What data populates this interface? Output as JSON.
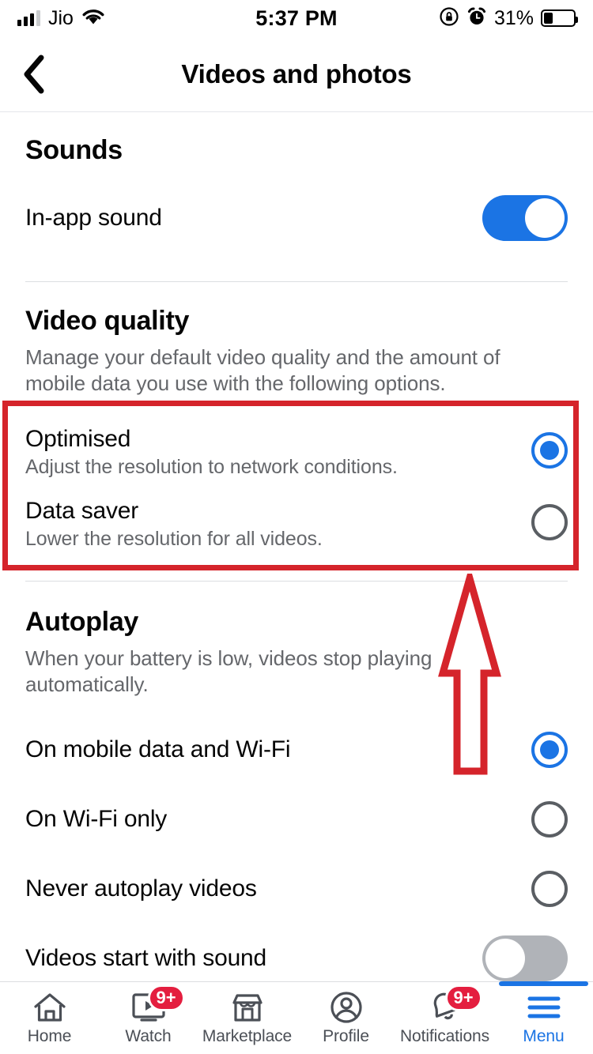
{
  "status_bar": {
    "carrier": "Jio",
    "time": "5:37 PM",
    "battery_percent": "31%",
    "icons": [
      "signal-bars-icon",
      "wifi-icon",
      "rotation-lock-icon",
      "alarm-icon",
      "battery-icon"
    ]
  },
  "header": {
    "back_icon": "chevron-left-icon",
    "title": "Videos and photos"
  },
  "sounds": {
    "heading": "Sounds",
    "in_app_sound": {
      "label": "In-app sound",
      "toggle_state": "on"
    }
  },
  "video_quality": {
    "heading": "Video quality",
    "description": "Manage your default video quality and the amount of mobile data you use with the following options.",
    "options": [
      {
        "title": "Optimised",
        "description": "Adjust the resolution to network conditions.",
        "selected": true
      },
      {
        "title": "Data saver",
        "description": "Lower the resolution for all videos.",
        "selected": false
      }
    ]
  },
  "autoplay": {
    "heading": "Autoplay",
    "description": "When your battery is low, videos stop playing automatically.",
    "options": [
      {
        "title": "On mobile data and Wi-Fi",
        "selected": true
      },
      {
        "title": "On Wi-Fi only",
        "selected": false
      },
      {
        "title": "Never autoplay videos",
        "selected": false
      }
    ],
    "videos_start_with_sound": {
      "label": "Videos start with sound",
      "toggle_state": "off"
    }
  },
  "annotation": {
    "color": "#d5242b",
    "box_target": "video-quality-options",
    "arrow_direction": "up"
  },
  "tab_bar": {
    "tabs": [
      {
        "label": "Home",
        "icon": "home-icon",
        "badge": "",
        "active": false
      },
      {
        "label": "Watch",
        "icon": "watch-video-icon",
        "badge": "9+",
        "active": false
      },
      {
        "label": "Marketplace",
        "icon": "marketplace-store-icon",
        "badge": "",
        "active": false
      },
      {
        "label": "Profile",
        "icon": "profile-person-icon",
        "badge": "",
        "active": false
      },
      {
        "label": "Notifications",
        "icon": "bell-icon",
        "badge": "9+",
        "active": false
      },
      {
        "label": "Menu",
        "icon": "hamburger-menu-icon",
        "badge": "",
        "active": true
      }
    ],
    "active_color": "#1b74e4",
    "badge_color": "#e41e3f"
  }
}
